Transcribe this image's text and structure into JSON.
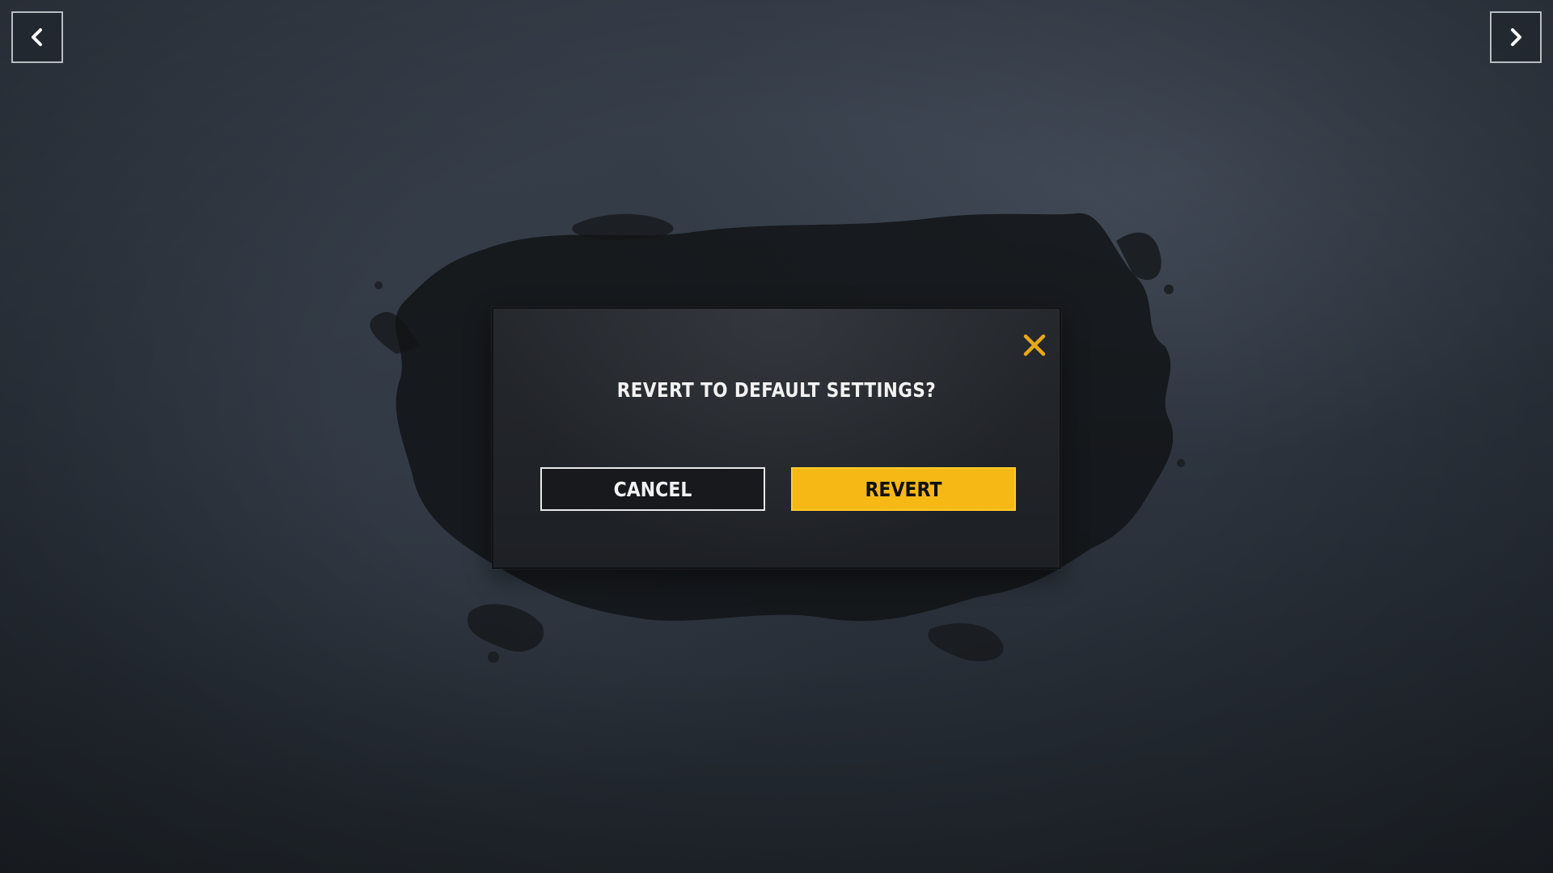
{
  "navigation": {
    "prev_icon": "chevron-left-icon",
    "next_icon": "chevron-right-icon"
  },
  "dialog": {
    "title": "REVERT TO DEFAULT SETTINGS?",
    "close_icon": "close-x-icon",
    "cancel_label": "CANCEL",
    "revert_label": "REVERT"
  },
  "colors": {
    "accent": "#f5b815",
    "close_icon": "#e8a918",
    "dialog_background": "#1f2226",
    "background": "#323a45"
  }
}
